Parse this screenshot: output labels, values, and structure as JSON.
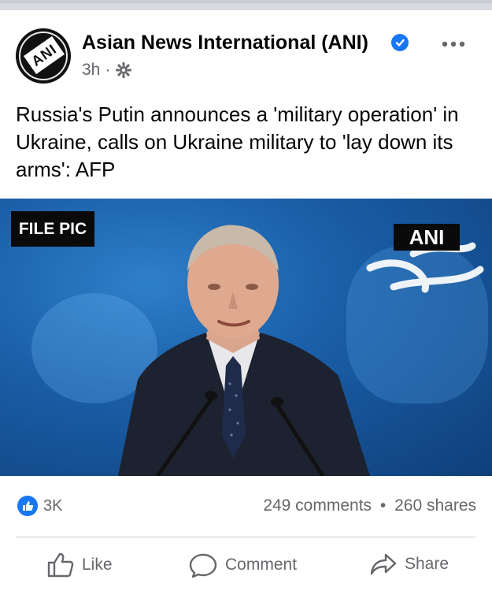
{
  "post": {
    "page_name": "Asian News International (ANI)",
    "time": "3h",
    "separator": "·",
    "avatar_text": "ANI",
    "text": "Russia's Putin announces a 'military operation' in Ukraine, calls on Ukraine military to 'lay down its arms': AFP"
  },
  "media": {
    "label": "FILE PIC",
    "watermark": "ANI"
  },
  "stats": {
    "reactions": "3K",
    "comments": "249 comments",
    "dot": "•",
    "shares": "260 shares"
  },
  "actions": {
    "like": "Like",
    "comment": "Comment",
    "share": "Share"
  },
  "icons": {
    "verified": "verified-badge-icon",
    "audience": "gear-icon",
    "more": "more-options-icon",
    "like": "thumbs-up-icon",
    "comment": "speech-bubble-icon",
    "share": "share-arrow-icon"
  },
  "colors": {
    "accent": "#1877f2",
    "secondary_text": "#65676b"
  }
}
